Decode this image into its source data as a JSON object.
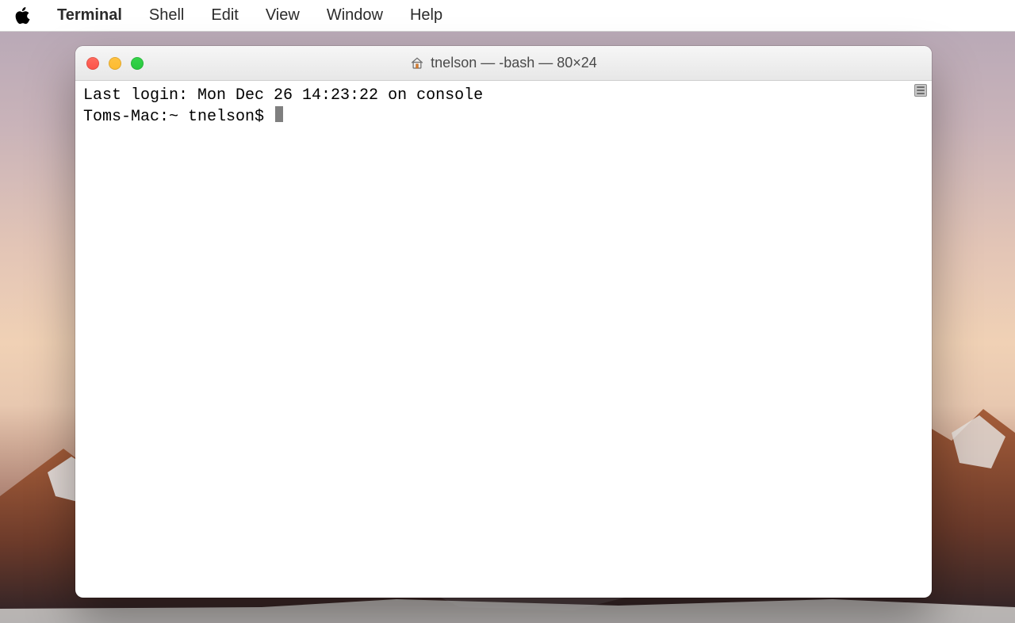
{
  "menubar": {
    "app_name": "Terminal",
    "items": [
      "Shell",
      "Edit",
      "View",
      "Window",
      "Help"
    ]
  },
  "window": {
    "title": "tnelson — -bash — 80×24",
    "traffic_lights": {
      "close": "#fc5248",
      "minimize": "#fdbb2f",
      "zoom": "#28c83e"
    }
  },
  "terminal": {
    "lines": [
      "Last login: Mon Dec 26 14:23:22 on console",
      "Toms-Mac:~ tnelson$ "
    ]
  }
}
